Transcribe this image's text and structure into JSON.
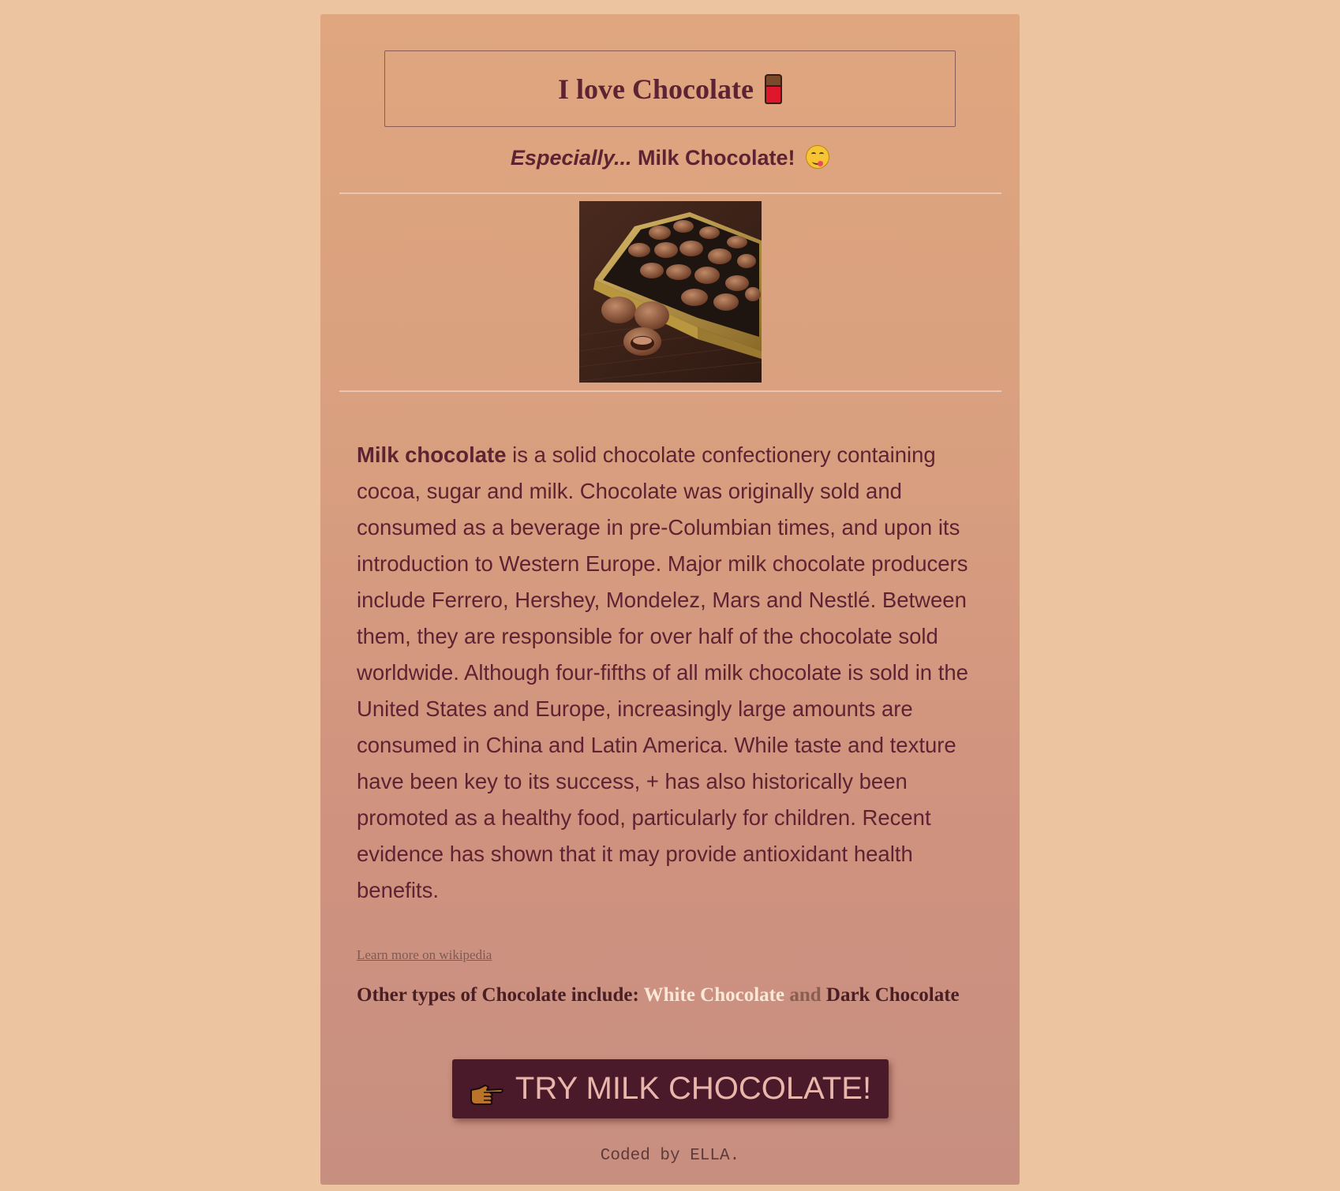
{
  "header": {
    "title": "I love Chocolate",
    "title_icon": "chocolate-bar-icon"
  },
  "subtitle": {
    "emphasis": "Especially...",
    "text": " Milk Chocolate!",
    "icon": "face-savoring-food-icon"
  },
  "image": {
    "alt": "Box of milk chocolates"
  },
  "article": {
    "lead_bold": "Milk chocolate",
    "body": " is a solid chocolate confectionery containing cocoa, sugar and milk. Chocolate was originally sold and consumed as a beverage in pre-Columbian times, and upon its introduction to Western Europe. Major milk chocolate producers include Ferrero, Hershey, Mondelez, Mars and Nestlé. Between them, they are responsible for over half of the chocolate sold worldwide. Although four-fifths of all milk chocolate is sold in the United States and Europe, increasingly large amounts are consumed in China and Latin America. While taste and texture have been key to its success, + has also historically been promoted as a healthy food, particularly for children. Recent evidence has shown that it may provide antioxidant health benefits."
  },
  "links": {
    "learn_more": "Learn more on wikipedia"
  },
  "other_types": {
    "prefix": "Other types of Chocolate include: ",
    "white": "White Chocolate",
    "and": " and ",
    "dark": "Dark Chocolate"
  },
  "cta": {
    "label": "TRY MILK CHOCOLATE!",
    "icon": "pointing-hand-icon"
  },
  "footer": {
    "text": "Coded by ELLA."
  },
  "colors": {
    "page_background": "#edc4a0",
    "heading": "#5e2333",
    "button_background": "#4a1a2a",
    "button_text": "#e9b6ab",
    "white_chocolate_link": "#fbe8d8"
  }
}
